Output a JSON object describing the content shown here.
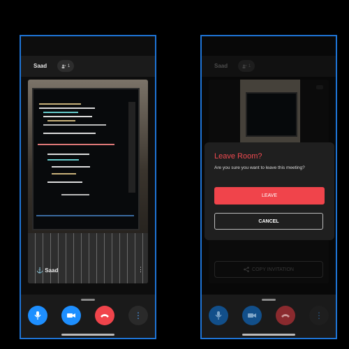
{
  "left_screen": {
    "user_name": "Saad",
    "participant_count": "1",
    "tile_label": "Saad",
    "tile_icon": "anchor-icon"
  },
  "right_screen": {
    "user_name": "Saad",
    "participant_count": "1",
    "dialog": {
      "title": "Leave Room?",
      "message": "Are you sure you want to leave this meeting?",
      "leave_label": "LEAVE",
      "cancel_label": "CANCEL"
    },
    "copy_invitation_label": "COPY INVITATION"
  },
  "colors": {
    "frame_border": "#1e74d6",
    "mic": "#1e8fff",
    "video": "#1e8fff",
    "end_call": "#f0444b",
    "more": "#2a2a2a",
    "dialog_accent": "#ef4a50"
  }
}
